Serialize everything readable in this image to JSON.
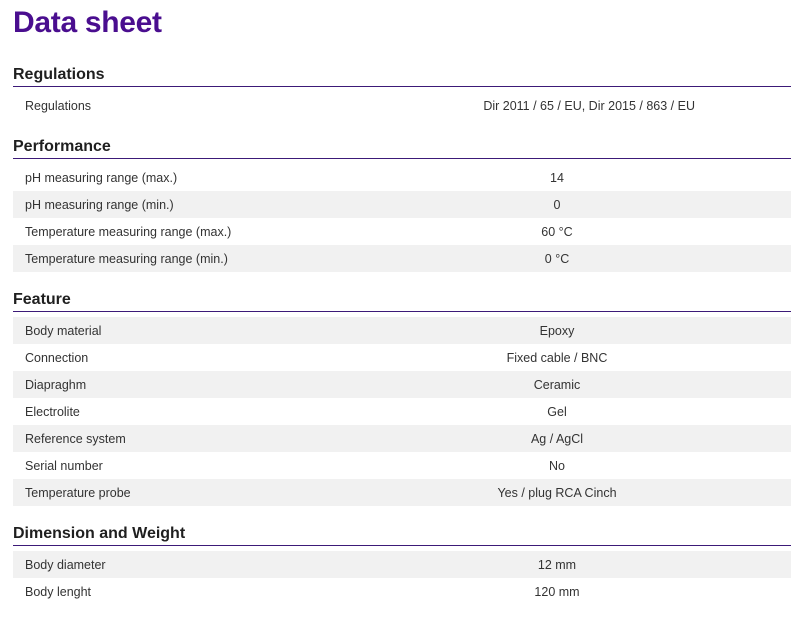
{
  "page": {
    "title": "Data sheet"
  },
  "colors": {
    "title": "#4a0e8f",
    "divider": "#3c1a78",
    "row_shade": "#f1f1f1"
  },
  "sections": [
    {
      "title": "Regulations",
      "rows": [
        {
          "label": "Regulations",
          "value": "Dir 2011 / 65 / EU, Dir 2015 / 863 / EU"
        }
      ]
    },
    {
      "title": "Performance",
      "rows": [
        {
          "label": "pH measuring range (max.)",
          "value": "14"
        },
        {
          "label": "pH measuring range (min.)",
          "value": "0"
        },
        {
          "label": "Temperature measuring range (max.)",
          "value": "60 °C"
        },
        {
          "label": "Temperature measuring range (min.)",
          "value": "0 °C"
        }
      ]
    },
    {
      "title": "Feature",
      "rows": [
        {
          "label": "Body material",
          "value": "Epoxy"
        },
        {
          "label": "Connection",
          "value": "Fixed cable / BNC"
        },
        {
          "label": "Diapraghm",
          "value": "Ceramic"
        },
        {
          "label": "Electrolite",
          "value": "Gel"
        },
        {
          "label": "Reference system",
          "value": "Ag / AgCl"
        },
        {
          "label": "Serial number",
          "value": "No"
        },
        {
          "label": "Temperature probe",
          "value": "Yes / plug RCA Cinch"
        }
      ]
    },
    {
      "title": "Dimension and Weight",
      "rows": [
        {
          "label": "Body diameter",
          "value": "12 mm"
        },
        {
          "label": "Body lenght",
          "value": "120 mm"
        }
      ]
    }
  ]
}
